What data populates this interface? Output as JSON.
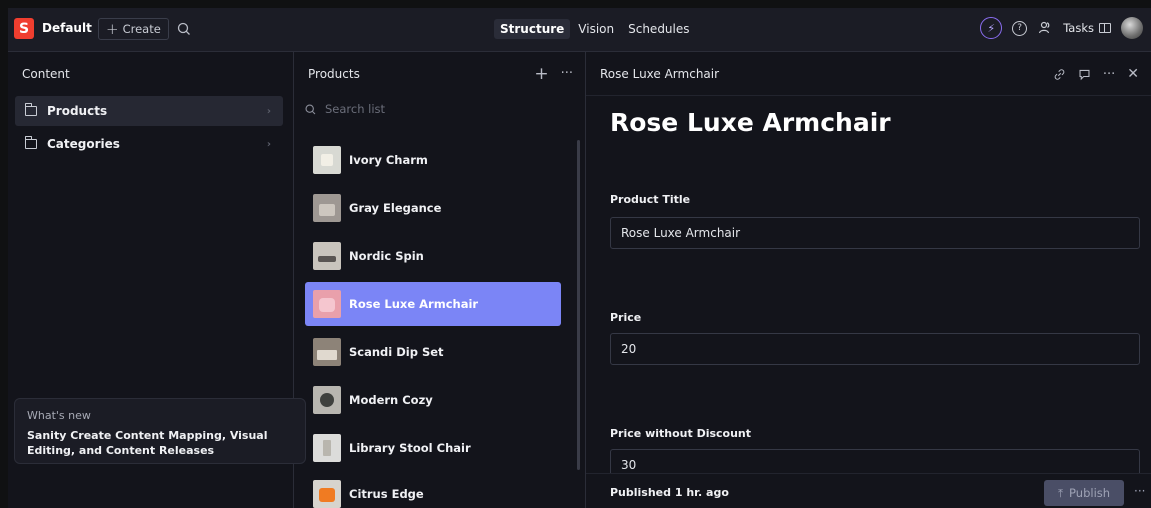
{
  "topbar": {
    "logo": "S",
    "workspace": "Default",
    "create_label": "Create",
    "create_icon": "plus-icon",
    "search_icon": "search-icon",
    "tabs": [
      {
        "label": "Structure",
        "active": true
      },
      {
        "label": "Vision",
        "active": false
      },
      {
        "label": "Schedules",
        "active": false
      }
    ],
    "tasks_label": "Tasks",
    "icons": [
      "bolt-icon",
      "help-icon",
      "people-icon",
      "panel-icon",
      "avatar"
    ]
  },
  "content_pane": {
    "title": "Content",
    "items": [
      {
        "label": "Products",
        "icon": "folder-icon",
        "selected": true
      },
      {
        "label": "Categories",
        "icon": "folder-icon",
        "selected": false
      }
    ]
  },
  "whats_new": {
    "title": "What's new",
    "text": "Sanity Create Content Mapping, Visual Editing, and Content Releases"
  },
  "products_pane": {
    "title": "Products",
    "search_placeholder": "Search list",
    "items": [
      {
        "label": "Ivory Charm",
        "selected": false
      },
      {
        "label": "Gray Elegance",
        "selected": false
      },
      {
        "label": "Nordic Spin",
        "selected": false
      },
      {
        "label": "Rose Luxe Armchair",
        "selected": true
      },
      {
        "label": "Scandi Dip Set",
        "selected": false
      },
      {
        "label": "Modern Cozy",
        "selected": false
      },
      {
        "label": "Library Stool Chair",
        "selected": false
      },
      {
        "label": "Citrus Edge",
        "selected": false
      }
    ]
  },
  "document": {
    "header_title": "Rose Luxe Armchair",
    "title": "Rose Luxe Armchair",
    "fields": [
      {
        "label": "Product Title",
        "value": "Rose Luxe Armchair"
      },
      {
        "label": "Price",
        "value": "20"
      },
      {
        "label": "Price without Discount",
        "value": "30"
      }
    ],
    "status": "Published 1 hr. ago",
    "publish_label": "Publish"
  },
  "colors": {
    "accent": "#7b85f6",
    "brand": "#f03e2f",
    "background": "#13141b"
  }
}
